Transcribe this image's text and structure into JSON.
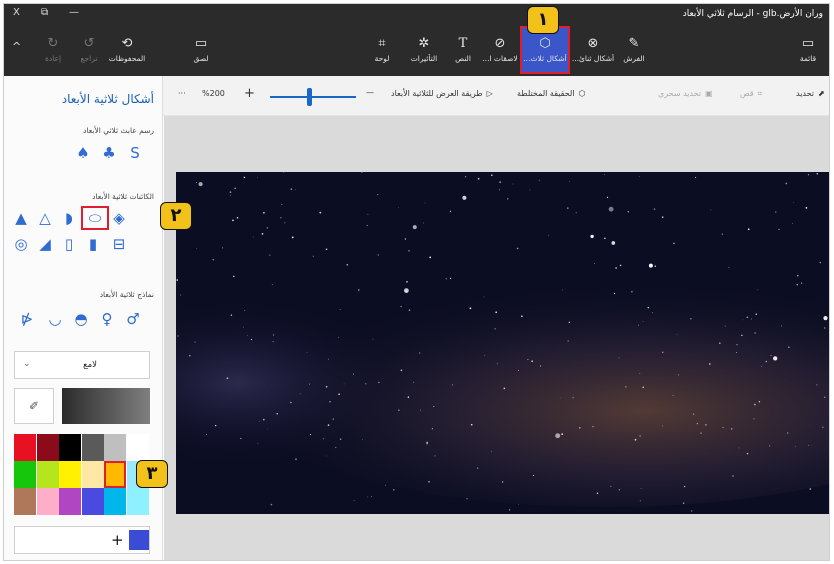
{
  "window": {
    "title": "وران الأرض.glb - الرسام ثلاثي الأبعاد",
    "close": "X",
    "restore": "⧉",
    "minimize": "—"
  },
  "ribbon": {
    "collapse": "^",
    "undo": "تراجع",
    "redo": "إعادة",
    "history": "المحفوظات",
    "paste": "لصق",
    "canvas": "لوحة",
    "effects": "التأثيرات",
    "text": "النص",
    "stickers": "لاصقات ا...",
    "shapes3d": "أشكال ثلاث...",
    "shapes2d": "أشكال ثنائ...",
    "brushes": "الفرش",
    "menu": "قائمة"
  },
  "subbar": {
    "more": "···",
    "zoom": "%200",
    "zoom_in": "+",
    "zoom_out": "—",
    "view3d": "طريقة العرض للثلاثية الأبعاد",
    "mixed_reality": "الحقيقة المختلطة",
    "magic_select": "تحديد سحري",
    "crop": "قص",
    "select": "تحديد",
    "zoom_level": 0.45
  },
  "panel": {
    "title": "أشكال ثلاثية الأبعاد",
    "doodle_label": "رسم عابث ثلاثي الأبعاد",
    "objects_label": "الكائنات ثلاثية الأبعاد",
    "models_label": "نماذج ثلاثية الأبعاد",
    "finish": "لامع",
    "chevron": "⌄",
    "add": "+"
  },
  "badges": [
    "١",
    "٢",
    "٣"
  ],
  "colors": {
    "ribbon_bg": "#2b2b2b",
    "selected_color": "#ffb900",
    "current_color": "#3a4bd6",
    "accent": "#1a5fb4",
    "highlight": "#e01e2e",
    "badge": "#f2c21b",
    "palette": [
      [
        "#e81123",
        "#8b0b1a",
        "#000000",
        "#5a5a5a",
        "#bfbfbf",
        "#ffffff"
      ],
      [
        "#16c60c",
        "#b5e61d",
        "#fff100",
        "#ffe8a6",
        "#ffb900",
        "#99e9ff"
      ],
      [
        "#b0785a",
        "#ffaec9",
        "#b146c2",
        "#4a4ae0",
        "#00b7eb",
        "#8ff0ff"
      ]
    ]
  },
  "icons": [
    "close-icon",
    "restore-icon",
    "minimize-icon",
    "collapse-icon",
    "undo-icon",
    "redo-icon",
    "history-icon",
    "paste-icon",
    "canvas-icon",
    "effects-icon",
    "text-icon",
    "sticker-icon",
    "cube-icon",
    "shapes2d-icon",
    "brush-icon",
    "menu-icon",
    "pointer-icon",
    "crop-icon",
    "magic-select-icon",
    "mixed-reality-icon",
    "view3d-icon",
    "eyedropper-icon"
  ]
}
